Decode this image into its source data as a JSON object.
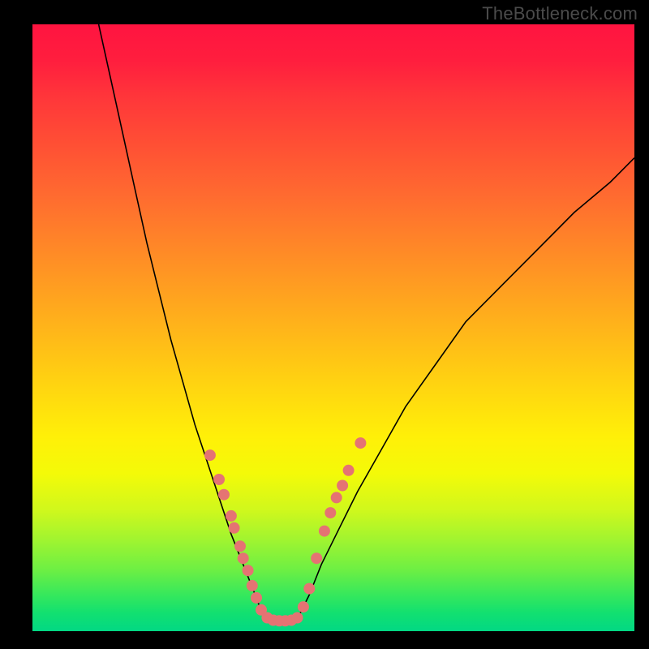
{
  "watermark": "TheBottleneck.com",
  "chart_data": {
    "type": "line",
    "title": "",
    "xlabel": "",
    "ylabel": "",
    "xlim": [
      0,
      100
    ],
    "ylim": [
      0,
      100
    ],
    "grid": false,
    "note": "Axes are unlabeled in the source image; values are estimated percentage coordinates of the plot area (0=left/bottom, 100=right/top).",
    "series": [
      {
        "name": "left-curve",
        "x": [
          11,
          13,
          15,
          17,
          19,
          21,
          23,
          25,
          27,
          29,
          31,
          33,
          35,
          37,
          38.5
        ],
        "y": [
          100,
          91,
          82,
          73,
          64,
          56,
          48,
          41,
          34,
          28,
          22,
          16,
          11,
          6,
          2
        ]
      },
      {
        "name": "right-curve",
        "x": [
          44,
          46,
          48,
          51,
          54,
          58,
          62,
          67,
          72,
          78,
          84,
          90,
          96,
          100
        ],
        "y": [
          2,
          6,
          11,
          17,
          23,
          30,
          37,
          44,
          51,
          57,
          63,
          69,
          74,
          78
        ]
      },
      {
        "name": "valley-floor",
        "x": [
          38.5,
          40,
          42,
          44
        ],
        "y": [
          2,
          1.6,
          1.6,
          2
        ]
      }
    ],
    "marker_points": {
      "name": "highlighted-dots",
      "color": "#e57373",
      "points": [
        {
          "x": 29.5,
          "y": 29
        },
        {
          "x": 31,
          "y": 25
        },
        {
          "x": 31.8,
          "y": 22.5
        },
        {
          "x": 33,
          "y": 19
        },
        {
          "x": 33.5,
          "y": 17
        },
        {
          "x": 34.5,
          "y": 14
        },
        {
          "x": 35,
          "y": 12
        },
        {
          "x": 35.8,
          "y": 10
        },
        {
          "x": 36.5,
          "y": 7.5
        },
        {
          "x": 37.2,
          "y": 5.5
        },
        {
          "x": 38,
          "y": 3.5
        },
        {
          "x": 39,
          "y": 2.2
        },
        {
          "x": 40,
          "y": 1.8
        },
        {
          "x": 41,
          "y": 1.7
        },
        {
          "x": 42,
          "y": 1.7
        },
        {
          "x": 43,
          "y": 1.8
        },
        {
          "x": 44,
          "y": 2.2
        },
        {
          "x": 45,
          "y": 4
        },
        {
          "x": 46,
          "y": 7
        },
        {
          "x": 47.2,
          "y": 12
        },
        {
          "x": 48.5,
          "y": 16.5
        },
        {
          "x": 49.5,
          "y": 19.5
        },
        {
          "x": 50.5,
          "y": 22
        },
        {
          "x": 51.5,
          "y": 24
        },
        {
          "x": 52.5,
          "y": 26.5
        },
        {
          "x": 54.5,
          "y": 31
        }
      ]
    }
  }
}
